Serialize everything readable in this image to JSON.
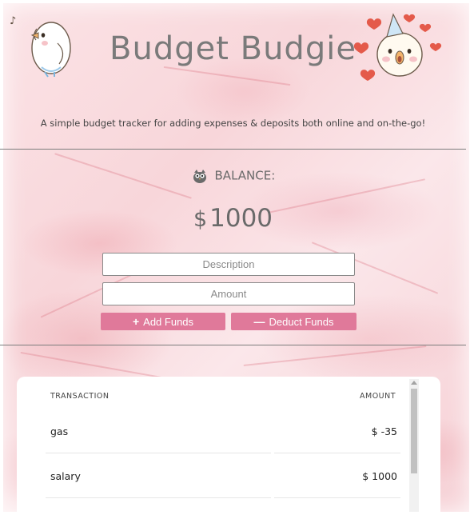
{
  "app": {
    "title": "Budget Budgie",
    "tagline": "A simple budget tracker for adding expenses & deposits both online and on-the-go!"
  },
  "balance": {
    "label": "BALANCE:",
    "currency": "$",
    "amount": "1000",
    "icon": "owl-icon"
  },
  "form": {
    "description_placeholder": "Description",
    "amount_placeholder": "Amount",
    "add_label": "Add Funds",
    "deduct_label": "Deduct Funds",
    "add_icon": "plus-icon",
    "deduct_icon": "minus-icon"
  },
  "table": {
    "columns": [
      "TRANSACTION",
      "AMOUNT"
    ],
    "rows": [
      {
        "transaction": "gas",
        "amount": "$ -35"
      },
      {
        "transaction": "salary",
        "amount": "$ 1000"
      }
    ]
  },
  "colors": {
    "accent": "#e0799a",
    "text": "#6a6a6a",
    "heart": "#e45a4a"
  }
}
